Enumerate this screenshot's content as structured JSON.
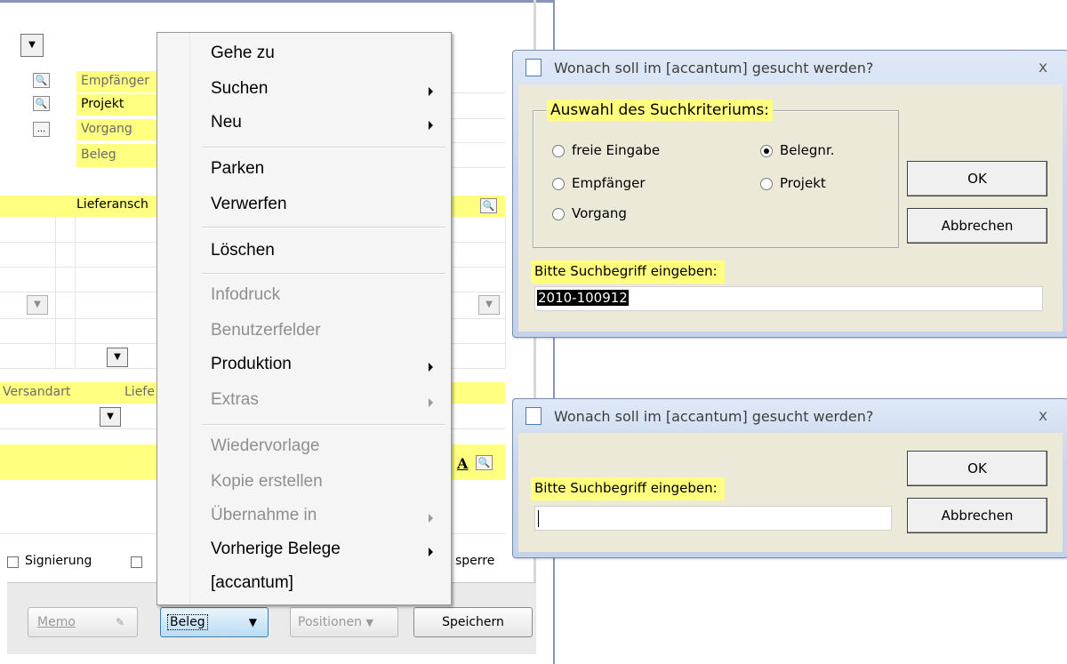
{
  "form": {
    "labels": {
      "empfaenger": "Empfänger",
      "projekt": "Projekt",
      "vorgang": "Vorgang",
      "beleg": "Beleg",
      "lieferanschrift": "Lieferansch",
      "versandart": "Versandart",
      "liefer": "Liefe",
      "signierung": "Signierung",
      "sperre": "sperre"
    },
    "buttons": {
      "memo": "Memo",
      "beleg": "Beleg",
      "positionen": "Positionen",
      "speichern": "Speichern"
    }
  },
  "context_menu": {
    "items": [
      {
        "label": "Gehe zu",
        "enabled": true,
        "submenu": false
      },
      {
        "label": "Suchen",
        "enabled": true,
        "submenu": true
      },
      {
        "label": "Neu",
        "enabled": true,
        "submenu": true
      },
      {
        "label": "Parken",
        "enabled": true,
        "submenu": false
      },
      {
        "label": "Verwerfen",
        "enabled": true,
        "submenu": false
      },
      {
        "label": "Löschen",
        "enabled": true,
        "submenu": false
      },
      {
        "label": "Infodruck",
        "enabled": false,
        "submenu": false
      },
      {
        "label": "Benutzerfelder",
        "enabled": false,
        "submenu": false
      },
      {
        "label": "Produktion",
        "enabled": true,
        "submenu": true
      },
      {
        "label": "Extras",
        "enabled": false,
        "submenu": true
      },
      {
        "label": "Wiedervorlage",
        "enabled": false,
        "submenu": false
      },
      {
        "label": "Kopie erstellen",
        "enabled": false,
        "submenu": false
      },
      {
        "label": "Übernahme in",
        "enabled": false,
        "submenu": true
      },
      {
        "label": "Vorherige Belege",
        "enabled": true,
        "submenu": true
      },
      {
        "label": "[accantum]",
        "enabled": true,
        "submenu": false
      }
    ]
  },
  "dialog1": {
    "title": "Wonach soll im [accantum] gesucht werden?",
    "close": "x",
    "group_label": "Auswahl des Suchkriteriums:",
    "options": [
      {
        "label": "freie Eingabe",
        "selected": false
      },
      {
        "label": "Empfänger",
        "selected": false
      },
      {
        "label": "Vorgang",
        "selected": false
      },
      {
        "label": "Belegnr.",
        "selected": true
      },
      {
        "label": "Projekt",
        "selected": false
      }
    ],
    "ok": "OK",
    "cancel": "Abbrechen",
    "prompt": "Bitte Suchbegriff eingeben:",
    "value": "2010-100912"
  },
  "dialog2": {
    "title": "Wonach soll im [accantum] gesucht werden?",
    "close": "x",
    "ok": "OK",
    "cancel": "Abbrechen",
    "prompt": "Bitte Suchbegriff eingeben:",
    "value": ""
  },
  "colors": {
    "highlight": "#ffff80",
    "menu_bg": "#f5f5f5",
    "dialog_title_bg": "#c9d8ee",
    "dialog_body_bg": "#ece9d8"
  }
}
